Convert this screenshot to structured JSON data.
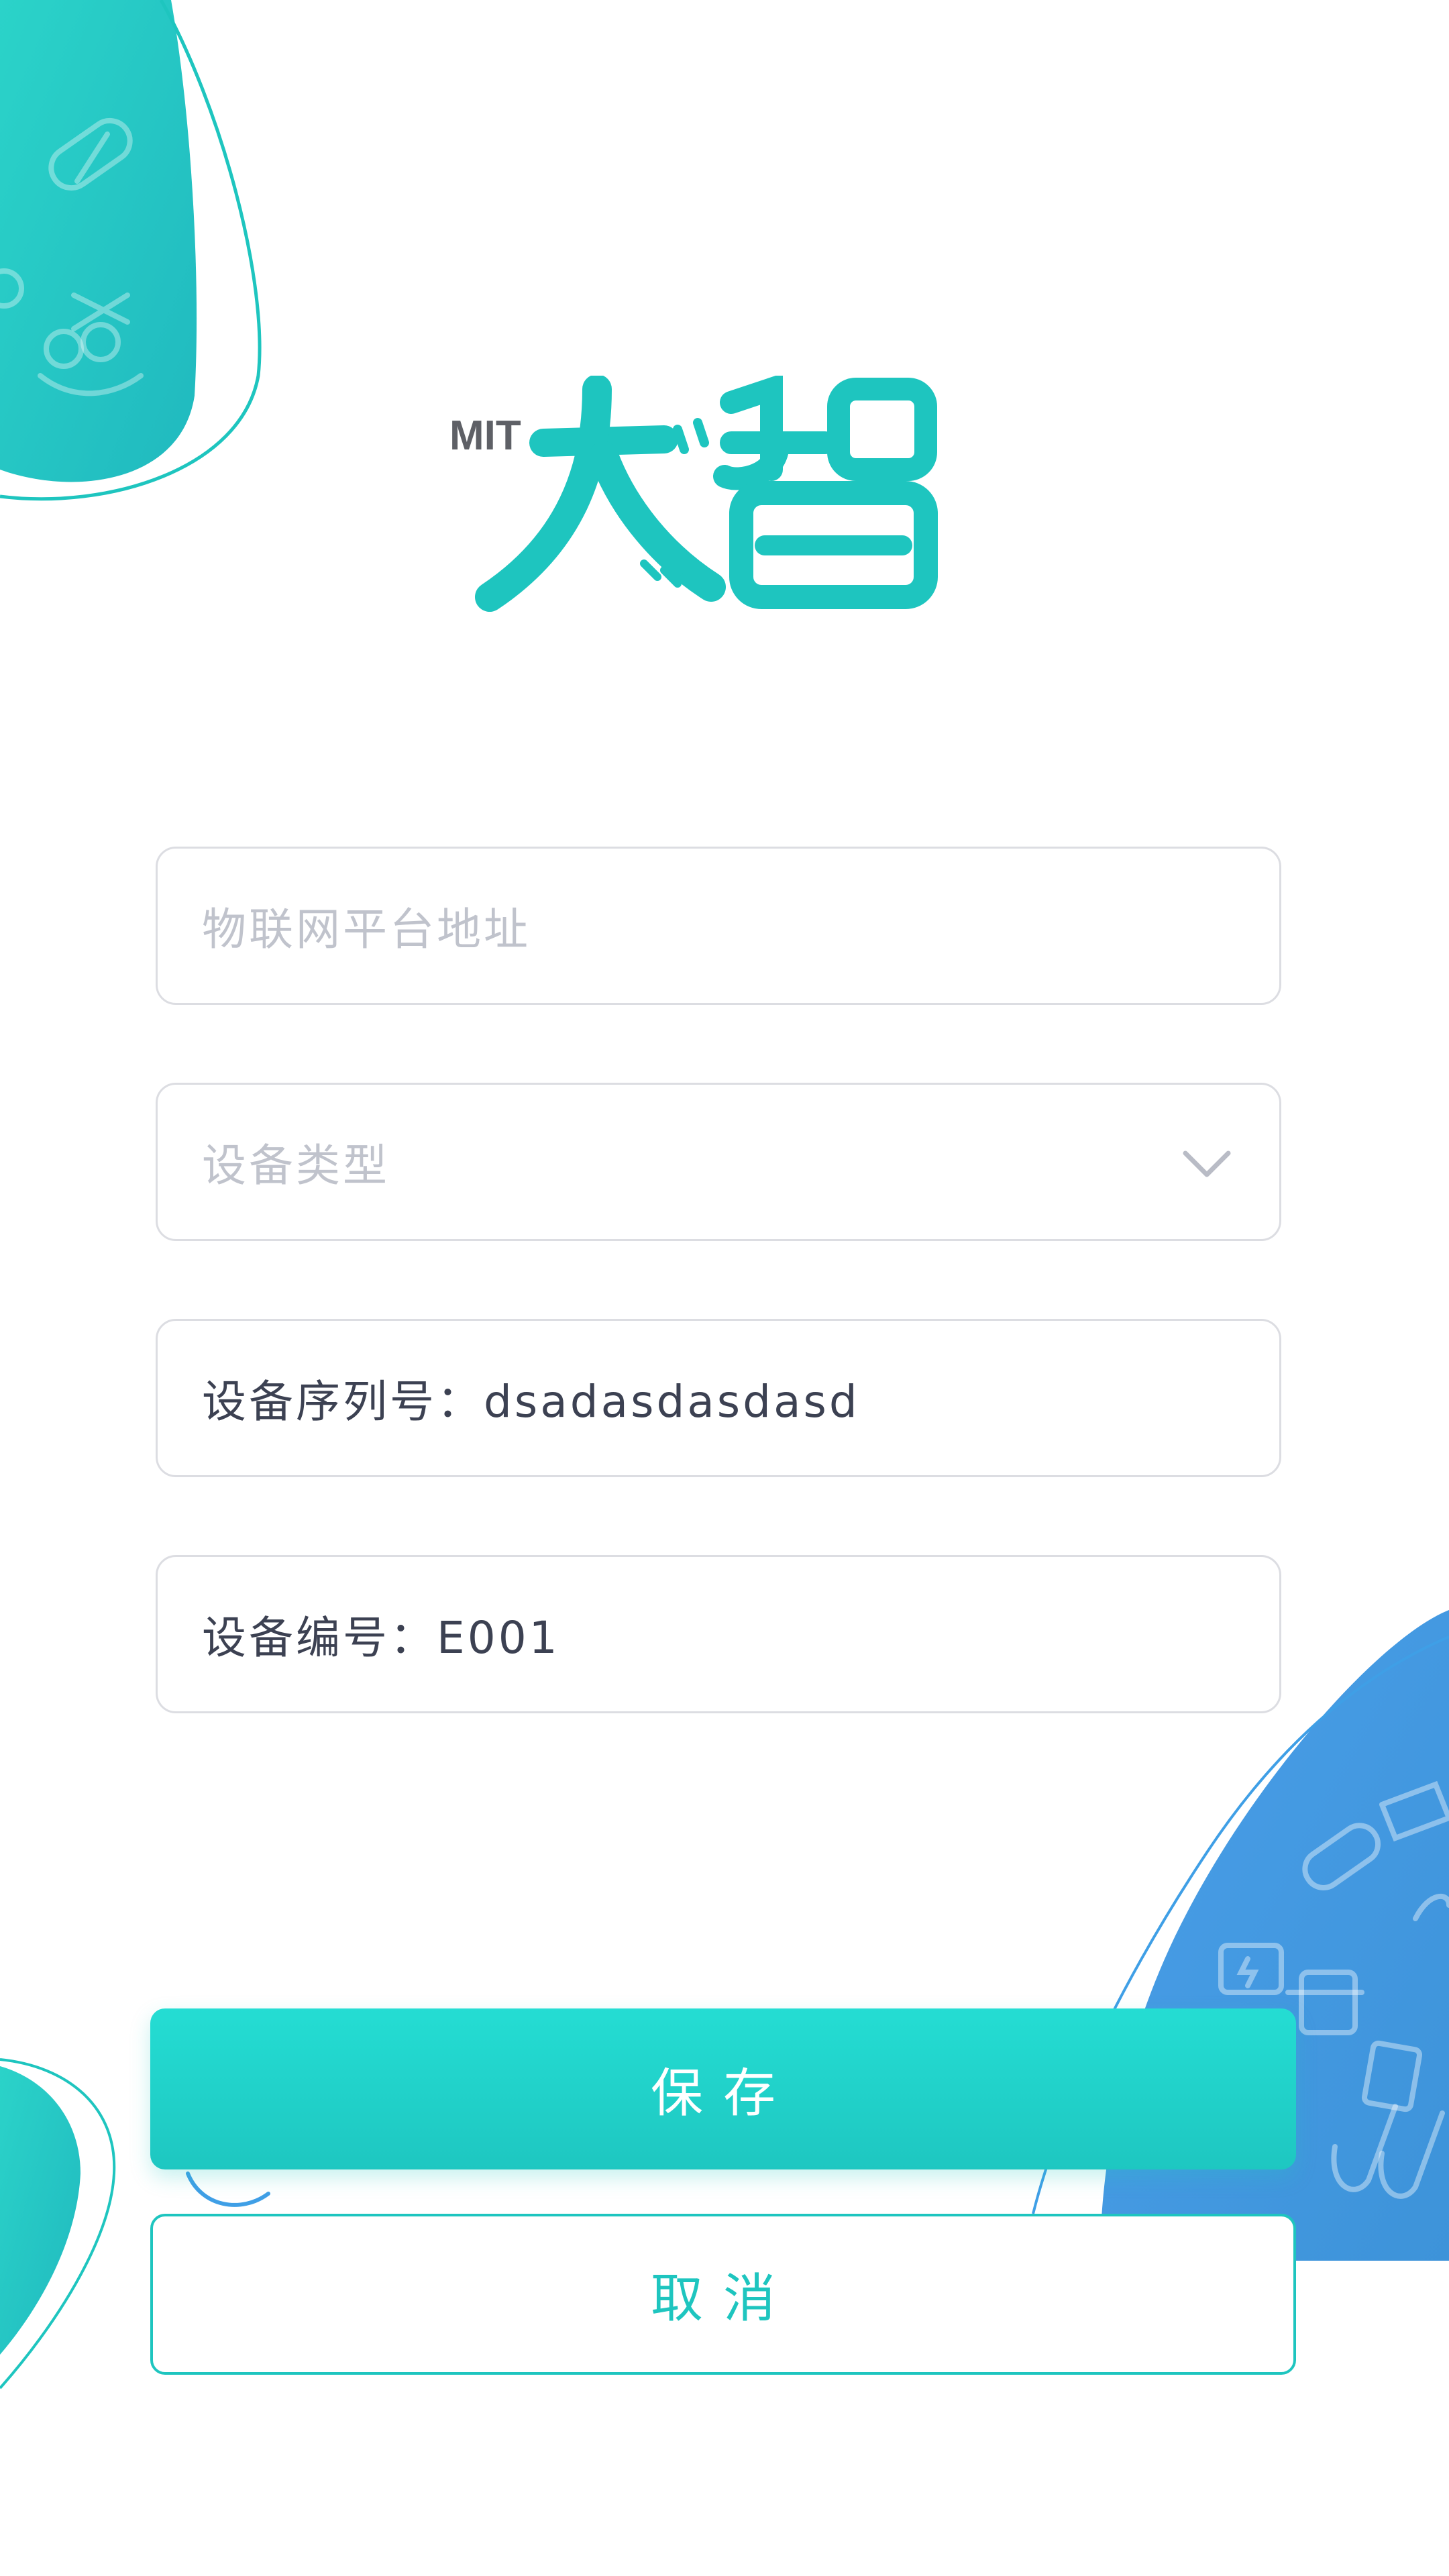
{
  "form": {
    "platform_address": {
      "placeholder": "物联网平台地址",
      "value": ""
    },
    "device_type": {
      "placeholder": "设备类型",
      "value": ""
    },
    "serial_number": {
      "text": "设备序列号：dsadasdasdasd"
    },
    "device_code": {
      "text": "设备编号：E001"
    }
  },
  "actions": {
    "save_label": "保存",
    "cancel_label": "取消"
  },
  "brand": {
    "logo_name": "MIT-dazhi-logo",
    "accent_color": "#1ec5bf",
    "secondary_color": "#3f9fe6"
  },
  "icons": {
    "device_type_dropdown": "chevron-down-icon"
  }
}
